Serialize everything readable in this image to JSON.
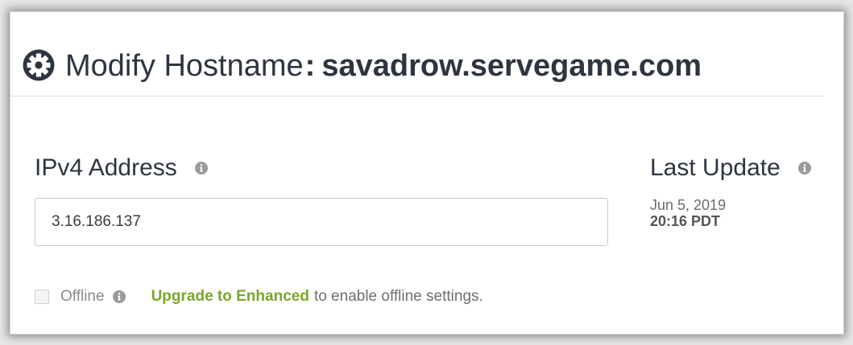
{
  "header": {
    "label": "Modify Hostname",
    "separator": ":",
    "hostname": "savadrow.servegame.com",
    "icon": "gear-icon"
  },
  "ipv4": {
    "label": "IPv4 Address",
    "value": "3.16.186.137",
    "info_icon": "info-icon"
  },
  "last_update": {
    "label": "Last Update",
    "date": "Jun 5, 2019",
    "time": "20:16 PDT",
    "info_icon": "info-icon"
  },
  "offline": {
    "label": "Offline",
    "checked": false,
    "upgrade_link": "Upgrade to Enhanced",
    "upgrade_text": "to enable offline settings."
  },
  "colors": {
    "title_text": "#2e3540",
    "link_green": "#7aa62a",
    "muted_text": "#8a8a8a",
    "info_icon": "#9a9a9a"
  }
}
